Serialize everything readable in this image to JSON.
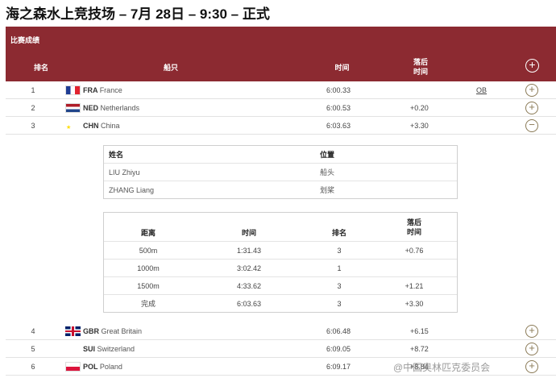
{
  "page": {
    "title": "海之森水上竞技场 – 7月 28日 – 9:30 – 正式"
  },
  "results": {
    "section_label": "比赛成绩",
    "columns": {
      "rank": "排名",
      "boat": "船只",
      "time": "时间",
      "behind": "落后\n时间"
    },
    "expand_all_glyph": "+",
    "rows": [
      {
        "rank": "1",
        "flag": "france-flag-icon",
        "code": "FRA",
        "country": "France",
        "time": "6:00.33",
        "behind": "",
        "note": "OB",
        "toggle": "+"
      },
      {
        "rank": "2",
        "flag": "netherlands-flag-icon",
        "code": "NED",
        "country": "Netherlands",
        "time": "6:00.53",
        "behind": "+0.20",
        "note": "",
        "toggle": "+"
      },
      {
        "rank": "3",
        "flag": "china-flag-icon",
        "code": "CHN",
        "country": "China",
        "time": "6:03.63",
        "behind": "+3.30",
        "note": "",
        "toggle": "−"
      },
      {
        "rank": "4",
        "flag": "great-britain-flag-icon",
        "code": "GBR",
        "country": "Great Britain",
        "time": "6:06.48",
        "behind": "+6.15",
        "note": "",
        "toggle": "+"
      },
      {
        "rank": "5",
        "flag": "switzerland-flag-icon",
        "code": "SUI",
        "country": "Switzerland",
        "time": "6:09.05",
        "behind": "+8.72",
        "note": "",
        "toggle": "+"
      },
      {
        "rank": "6",
        "flag": "poland-flag-icon",
        "code": "POL",
        "country": "Poland",
        "time": "6:09.17",
        "behind": "+8.84",
        "note": "",
        "toggle": "+"
      }
    ]
  },
  "crew": {
    "headers": {
      "name": "姓名",
      "position": "位置"
    },
    "members": [
      {
        "name": "LIU Zhiyu",
        "position": "船头"
      },
      {
        "name": "ZHANG Liang",
        "position": "划桨"
      }
    ]
  },
  "splits": {
    "headers": {
      "distance": "距离",
      "time": "时间",
      "rank": "排名",
      "behind": "落后\n时间"
    },
    "rows": [
      {
        "distance": "500m",
        "time": "1:31.43",
        "rank": "3",
        "behind": "+0.76"
      },
      {
        "distance": "1000m",
        "time": "3:02.42",
        "rank": "1",
        "behind": ""
      },
      {
        "distance": "1500m",
        "time": "4:33.62",
        "rank": "3",
        "behind": "+1.21"
      },
      {
        "distance": "完成",
        "time": "6:03.63",
        "rank": "3",
        "behind": "+3.30"
      }
    ]
  },
  "watermark": "@中国奥林匹克委员会",
  "colors": {
    "header_bg": "#8c2a31",
    "toggle": "#8a7a56"
  }
}
